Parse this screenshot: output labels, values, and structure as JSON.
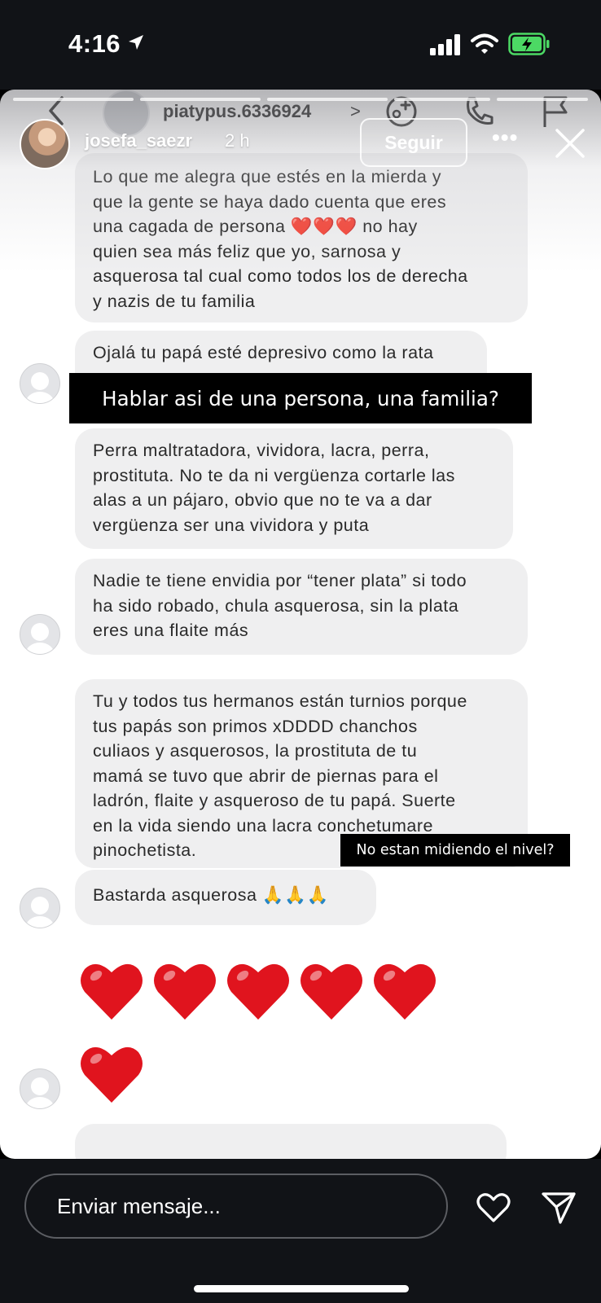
{
  "status_bar": {
    "time": "4:16",
    "icons": [
      "location-arrow-icon",
      "cellular-signal-icon",
      "wifi-icon",
      "battery-charging-icon"
    ],
    "battery_color": "#4cd964"
  },
  "story": {
    "poster_username": "josefa_saezr",
    "posted_ago": "2 h",
    "follow_label": "Seguir",
    "more_label": "•••",
    "caption_top": "Hablar asi de una persona, una familia?",
    "caption_bottom": "No estan midiendo el nivel?"
  },
  "dm_header": {
    "username": "piatypus.6336924",
    "chevron": ">",
    "icons": [
      "back-chevron-icon",
      "video-call-icon",
      "phone-icon",
      "flag-icon"
    ]
  },
  "messages": [
    {
      "lines": [
        "Lo que me alegra que estés en la mierda y",
        "que la gente se haya dado cuenta que eres",
        "una cagada de persona ❤️❤️❤️ no hay",
        "quien sea más feliz que yo, sarnosa y",
        "asquerosa tal cual como todos los de derecha",
        "y nazis de tu familia"
      ]
    },
    {
      "lines": [
        "Ojalá tu papá esté depresivo como la rata"
      ]
    },
    {
      "lines": [
        "Perra maltratadora, vividora, lacra, perra,",
        "prostituta. No te da ni vergüenza cortarle las",
        "alas a un pájaro, obvio que no te va a dar",
        "vergüenza ser una vividora y puta"
      ]
    },
    {
      "lines": [
        "Nadie te tiene envidia por “tener plata” si todo",
        "ha sido robado, chula asquerosa, sin la plata",
        "eres una flaite más"
      ]
    },
    {
      "lines": [
        "Tu y todos tus hermanos están turnios porque",
        "tus papás son primos xDDDD chanchos",
        "culiaos y asquerosos, la prostituta de tu",
        "mamá se tuvo que abrir de piernas para el",
        "ladrón, flaite y asqueroso de tu papá. Suerte",
        "en la vida siendo una lacra conchetumare",
        "pinochetista."
      ]
    },
    {
      "lines": [
        "Bastarda asquerosa 🙏🙏🙏"
      ]
    }
  ],
  "heart_message_count": 6,
  "heart_color": "#e0141e",
  "reply_bar": {
    "placeholder": "Enviar mensaje...",
    "icons": [
      "heart-outline-icon",
      "send-paper-plane-icon"
    ]
  }
}
